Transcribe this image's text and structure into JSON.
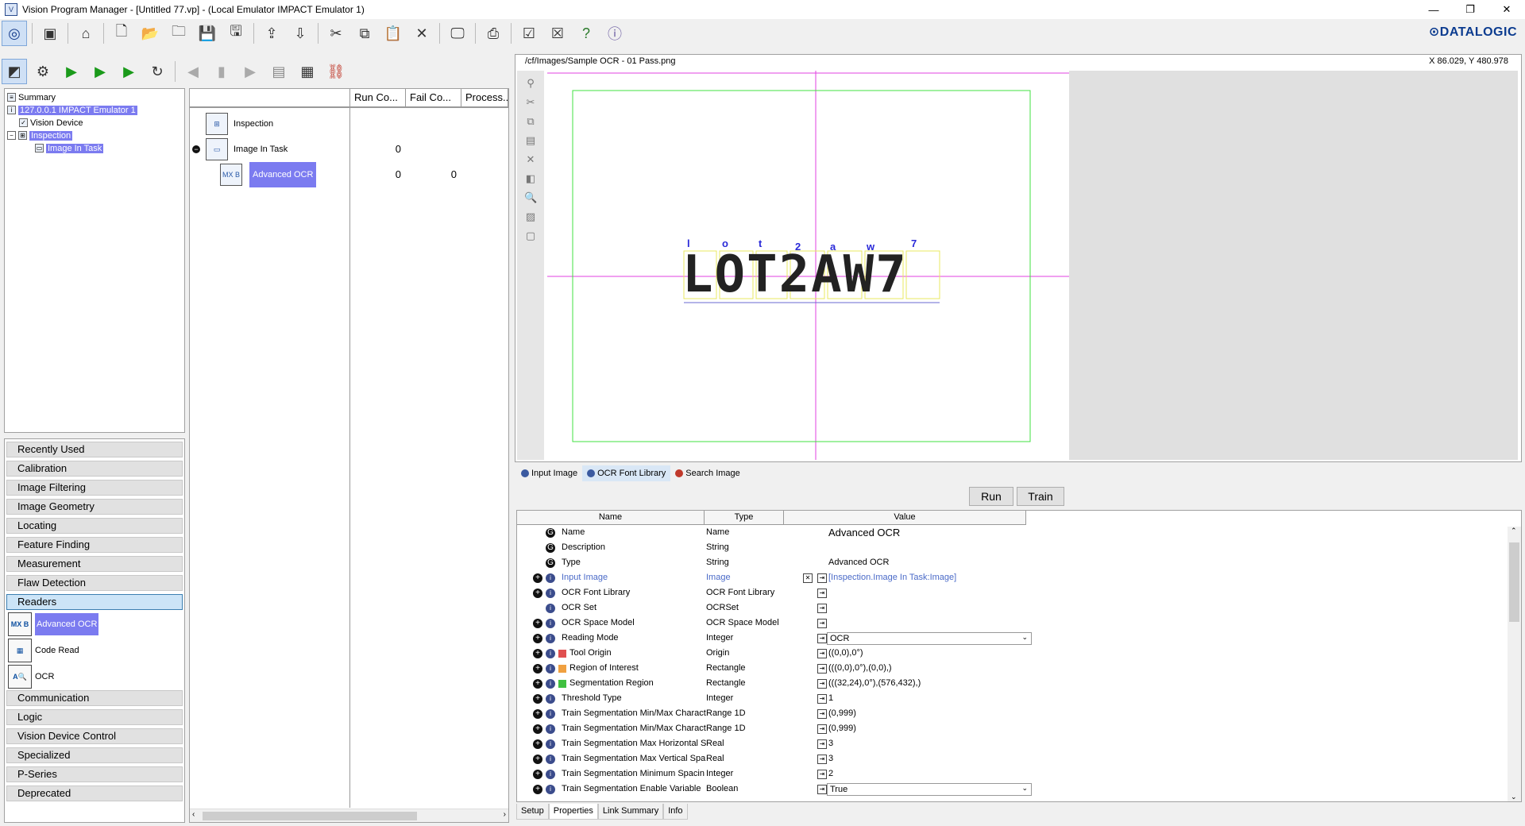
{
  "window": {
    "title": "Vision Program Manager - [Untitled 77.vp] - (Local Emulator IMPACT Emulator 1)",
    "brand": "DATALOGIC",
    "controls": [
      "—",
      "❐",
      "✕"
    ]
  },
  "tree": {
    "items": [
      {
        "label": "Summary"
      },
      {
        "label": "127.0.0.1 IMPACT Emulator 1"
      },
      {
        "label": "Vision Device"
      },
      {
        "label": "Inspection"
      },
      {
        "label": "Image In Task"
      }
    ]
  },
  "categories": {
    "top": [
      "Recently Used",
      "Calibration",
      "Image Filtering",
      "Image Geometry",
      "Locating",
      "Feature Finding",
      "Measurement",
      "Flaw Detection",
      "Readers"
    ],
    "tools": [
      {
        "label": "Advanced OCR",
        "icon": "advanced-ocr-icon"
      },
      {
        "label": "Code Read",
        "icon": "code-read-icon"
      },
      {
        "label": "OCR",
        "icon": "ocr-icon"
      }
    ],
    "bottom": [
      "Communication",
      "Logic",
      "Vision Device Control",
      "Specialized",
      "P-Series",
      "Deprecated"
    ]
  },
  "task": {
    "columns": [
      "Run Co...",
      "Fail Co...",
      "Process..."
    ],
    "rows": [
      {
        "label": "Inspection",
        "run": "",
        "fail": ""
      },
      {
        "label": "Image In Task",
        "run": "0",
        "fail": ""
      },
      {
        "label": "Advanced OCR",
        "run": "0",
        "fail": "0"
      }
    ]
  },
  "viewer": {
    "path": "/cf/Images/Sample OCR - 01 Pass.png",
    "coords": "X 86.029,  Y 480.978",
    "ocr_text": "LOT2AW7",
    "char_labels": [
      "l",
      "o",
      "t",
      "2",
      "a",
      "w",
      "7"
    ]
  },
  "view_tabs": [
    {
      "label": "Input Image",
      "dot": "#3b5aa0"
    },
    {
      "label": "OCR Font Library",
      "dot": "#3b5aa0"
    },
    {
      "label": "Search Image",
      "dot": "#c0392b"
    }
  ],
  "actions": {
    "run": "Run",
    "train": "Train"
  },
  "props": {
    "headers": {
      "name": "Name",
      "type": "Type",
      "value": "Value"
    },
    "rows": [
      {
        "name": "Name",
        "type": "Name",
        "value": "Advanced OCR"
      },
      {
        "name": "Description",
        "type": "String",
        "value": ""
      },
      {
        "name": "Type",
        "type": "String",
        "value": "Advanced OCR"
      },
      {
        "name": "Input Image",
        "type": "Image",
        "value": "[Inspection.Image In Task:Image]"
      },
      {
        "name": "OCR Font Library",
        "type": "OCR Font Library",
        "value": ""
      },
      {
        "name": "OCR Set",
        "type": "OCRSet",
        "value": ""
      },
      {
        "name": "OCR Space Model",
        "type": "OCR Space Model",
        "value": ""
      },
      {
        "name": "Reading Mode",
        "type": "Integer",
        "value": "OCR"
      },
      {
        "name": "Tool Origin",
        "type": "Origin",
        "value": "((0,0),0°)"
      },
      {
        "name": "Region of Interest",
        "type": "Rectangle",
        "value": "(((0,0),0°),(0,0),)"
      },
      {
        "name": "Segmentation Region",
        "type": "Rectangle",
        "value": "(((32,24),0°),(576,432),)"
      },
      {
        "name": "Threshold Type",
        "type": "Integer",
        "value": "1"
      },
      {
        "name": "Train Segmentation Min/Max Charact",
        "type": "Range 1D",
        "value": "(0,999)"
      },
      {
        "name": "Train Segmentation Min/Max Charact",
        "type": "Range 1D",
        "value": "(0,999)"
      },
      {
        "name": "Train Segmentation Max Horizontal S",
        "type": "Real",
        "value": "3"
      },
      {
        "name": "Train Segmentation Max Vertical Spa",
        "type": "Real",
        "value": "3"
      },
      {
        "name": "Train Segmentation Minimum Spacin",
        "type": "Integer",
        "value": "2"
      },
      {
        "name": "Train Segmentation Enable Variable",
        "type": "Boolean",
        "value": "True"
      }
    ]
  },
  "bottom_tabs": [
    "Setup",
    "Properties",
    "Link Summary",
    "Info"
  ]
}
